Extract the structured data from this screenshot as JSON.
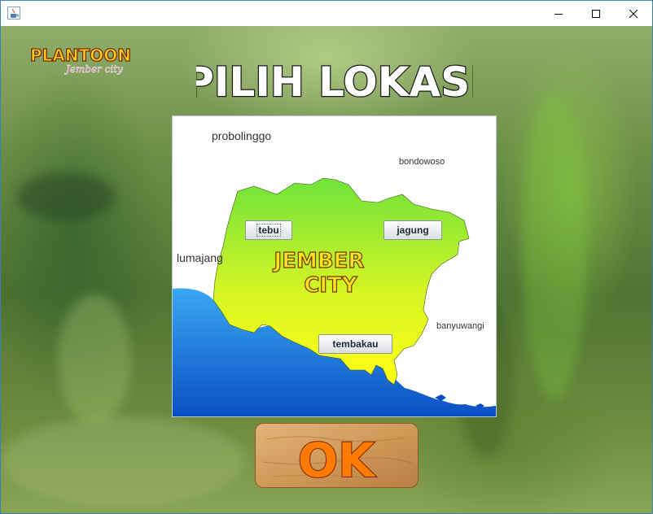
{
  "window": {
    "icons": {
      "app": "java-cup-icon",
      "minimize": "minimize-icon",
      "maximize": "maximize-icon",
      "close": "close-icon"
    }
  },
  "logo": {
    "main": "PLANTOON",
    "sub": "Jember city"
  },
  "title": "PILIH LOKASI",
  "map": {
    "places": {
      "probolinggo": "probolinggo",
      "bondowoso": "bondowoso",
      "lumajang": "lumajang",
      "banyuwangi": "banyuwangi"
    },
    "region_line1": "JEMBER",
    "region_line2": "CITY",
    "buttons": {
      "tebu": "tebu",
      "jagung": "jagung",
      "tembakau": "tembakau"
    }
  },
  "ok_label": "OK",
  "colors": {
    "region_top": "#7ee83a",
    "region_bottom": "#ffff1a",
    "sea_light": "#3aa0f0",
    "sea_dark": "#0a58c8",
    "title_fill": "#ffffff",
    "ok_fill": "#ff7a00",
    "board_wood": "#d6a062"
  }
}
